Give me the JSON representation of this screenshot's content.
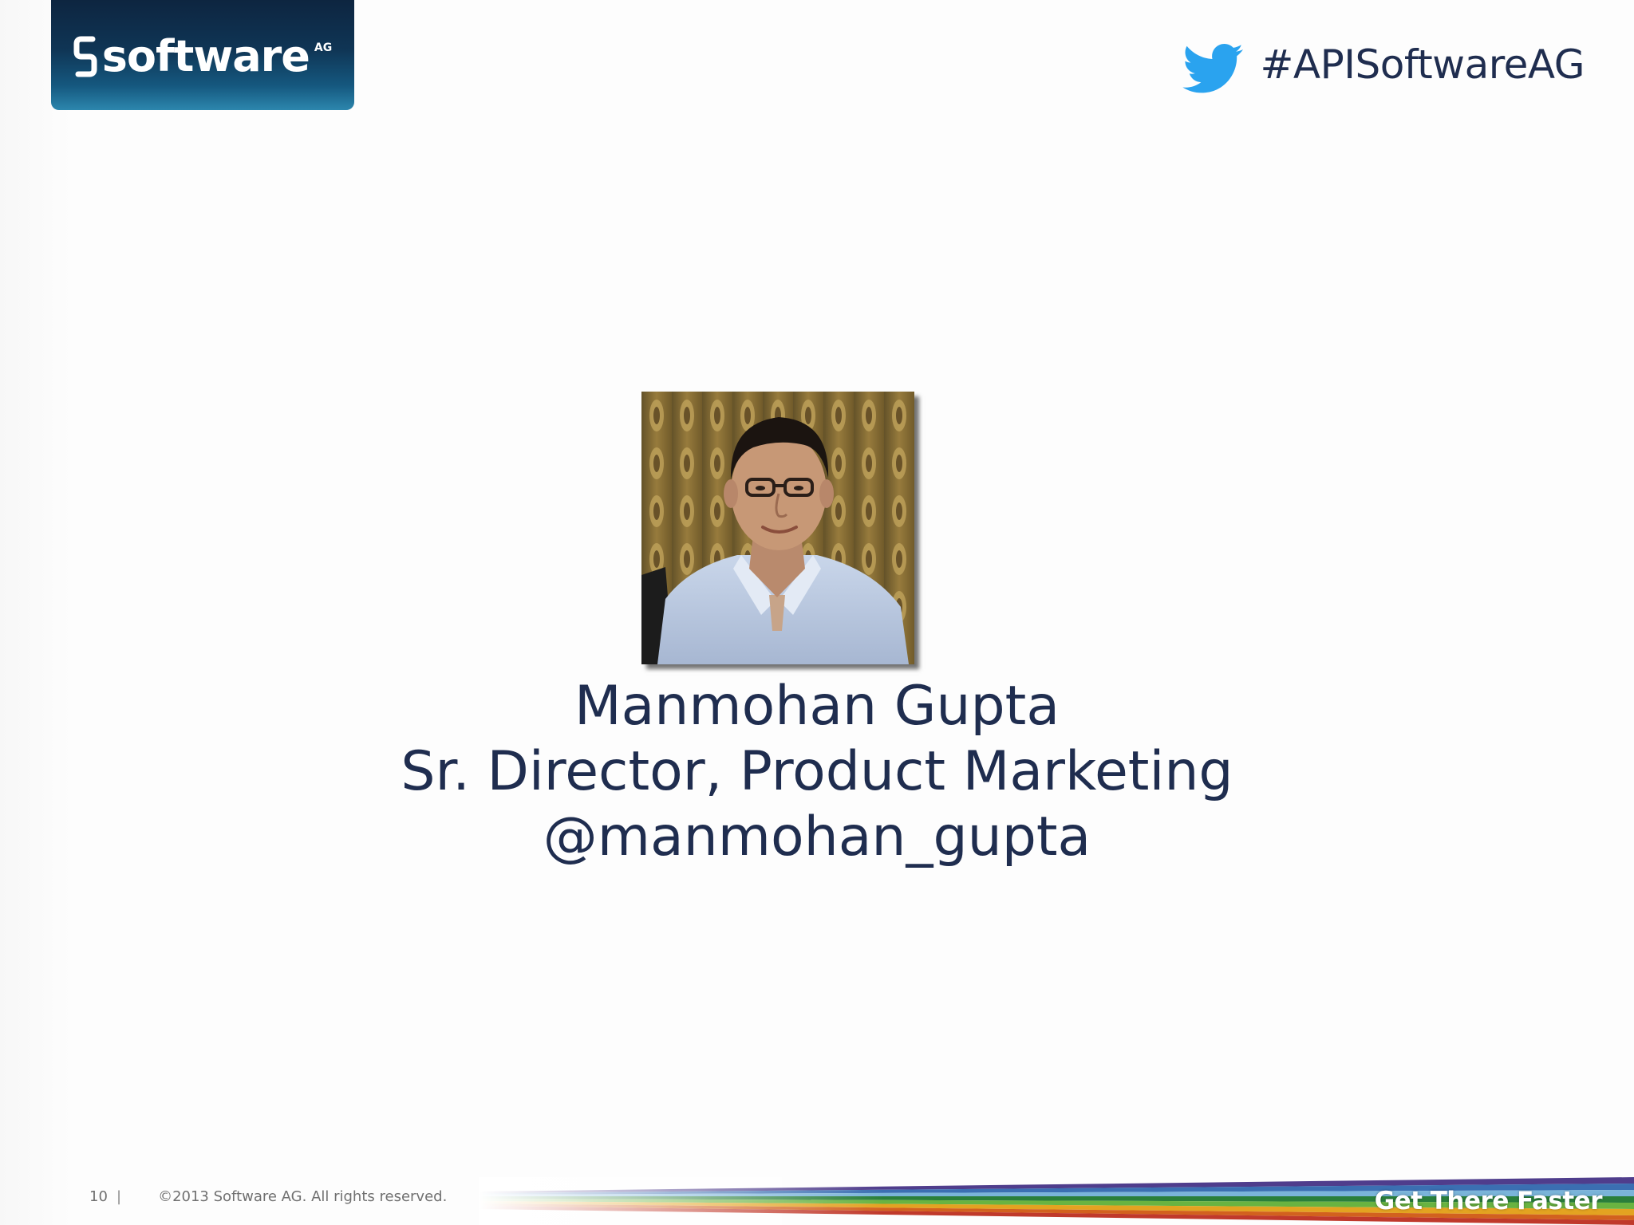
{
  "brand": {
    "logo_word": "software",
    "logo_suffix": "AG"
  },
  "header": {
    "hashtag": "#APISoftwareAG"
  },
  "speaker": {
    "name": "Manmohan Gupta",
    "title": "Sr. Director, Product Marketing",
    "handle": "@manmohan_gupta"
  },
  "footer": {
    "page_number": "10",
    "separator": "|",
    "copyright": "©2013 Software AG. All rights reserved.",
    "tagline": "Get There Faster"
  },
  "colors": {
    "text_navy": "#1f2d4f",
    "logo_dark": "#0d2540",
    "logo_light": "#2c86ad",
    "twitter_blue": "#2aa3ef"
  },
  "icons": {
    "twitter": "twitter-bird-icon",
    "logo": "software-ag-logo"
  }
}
